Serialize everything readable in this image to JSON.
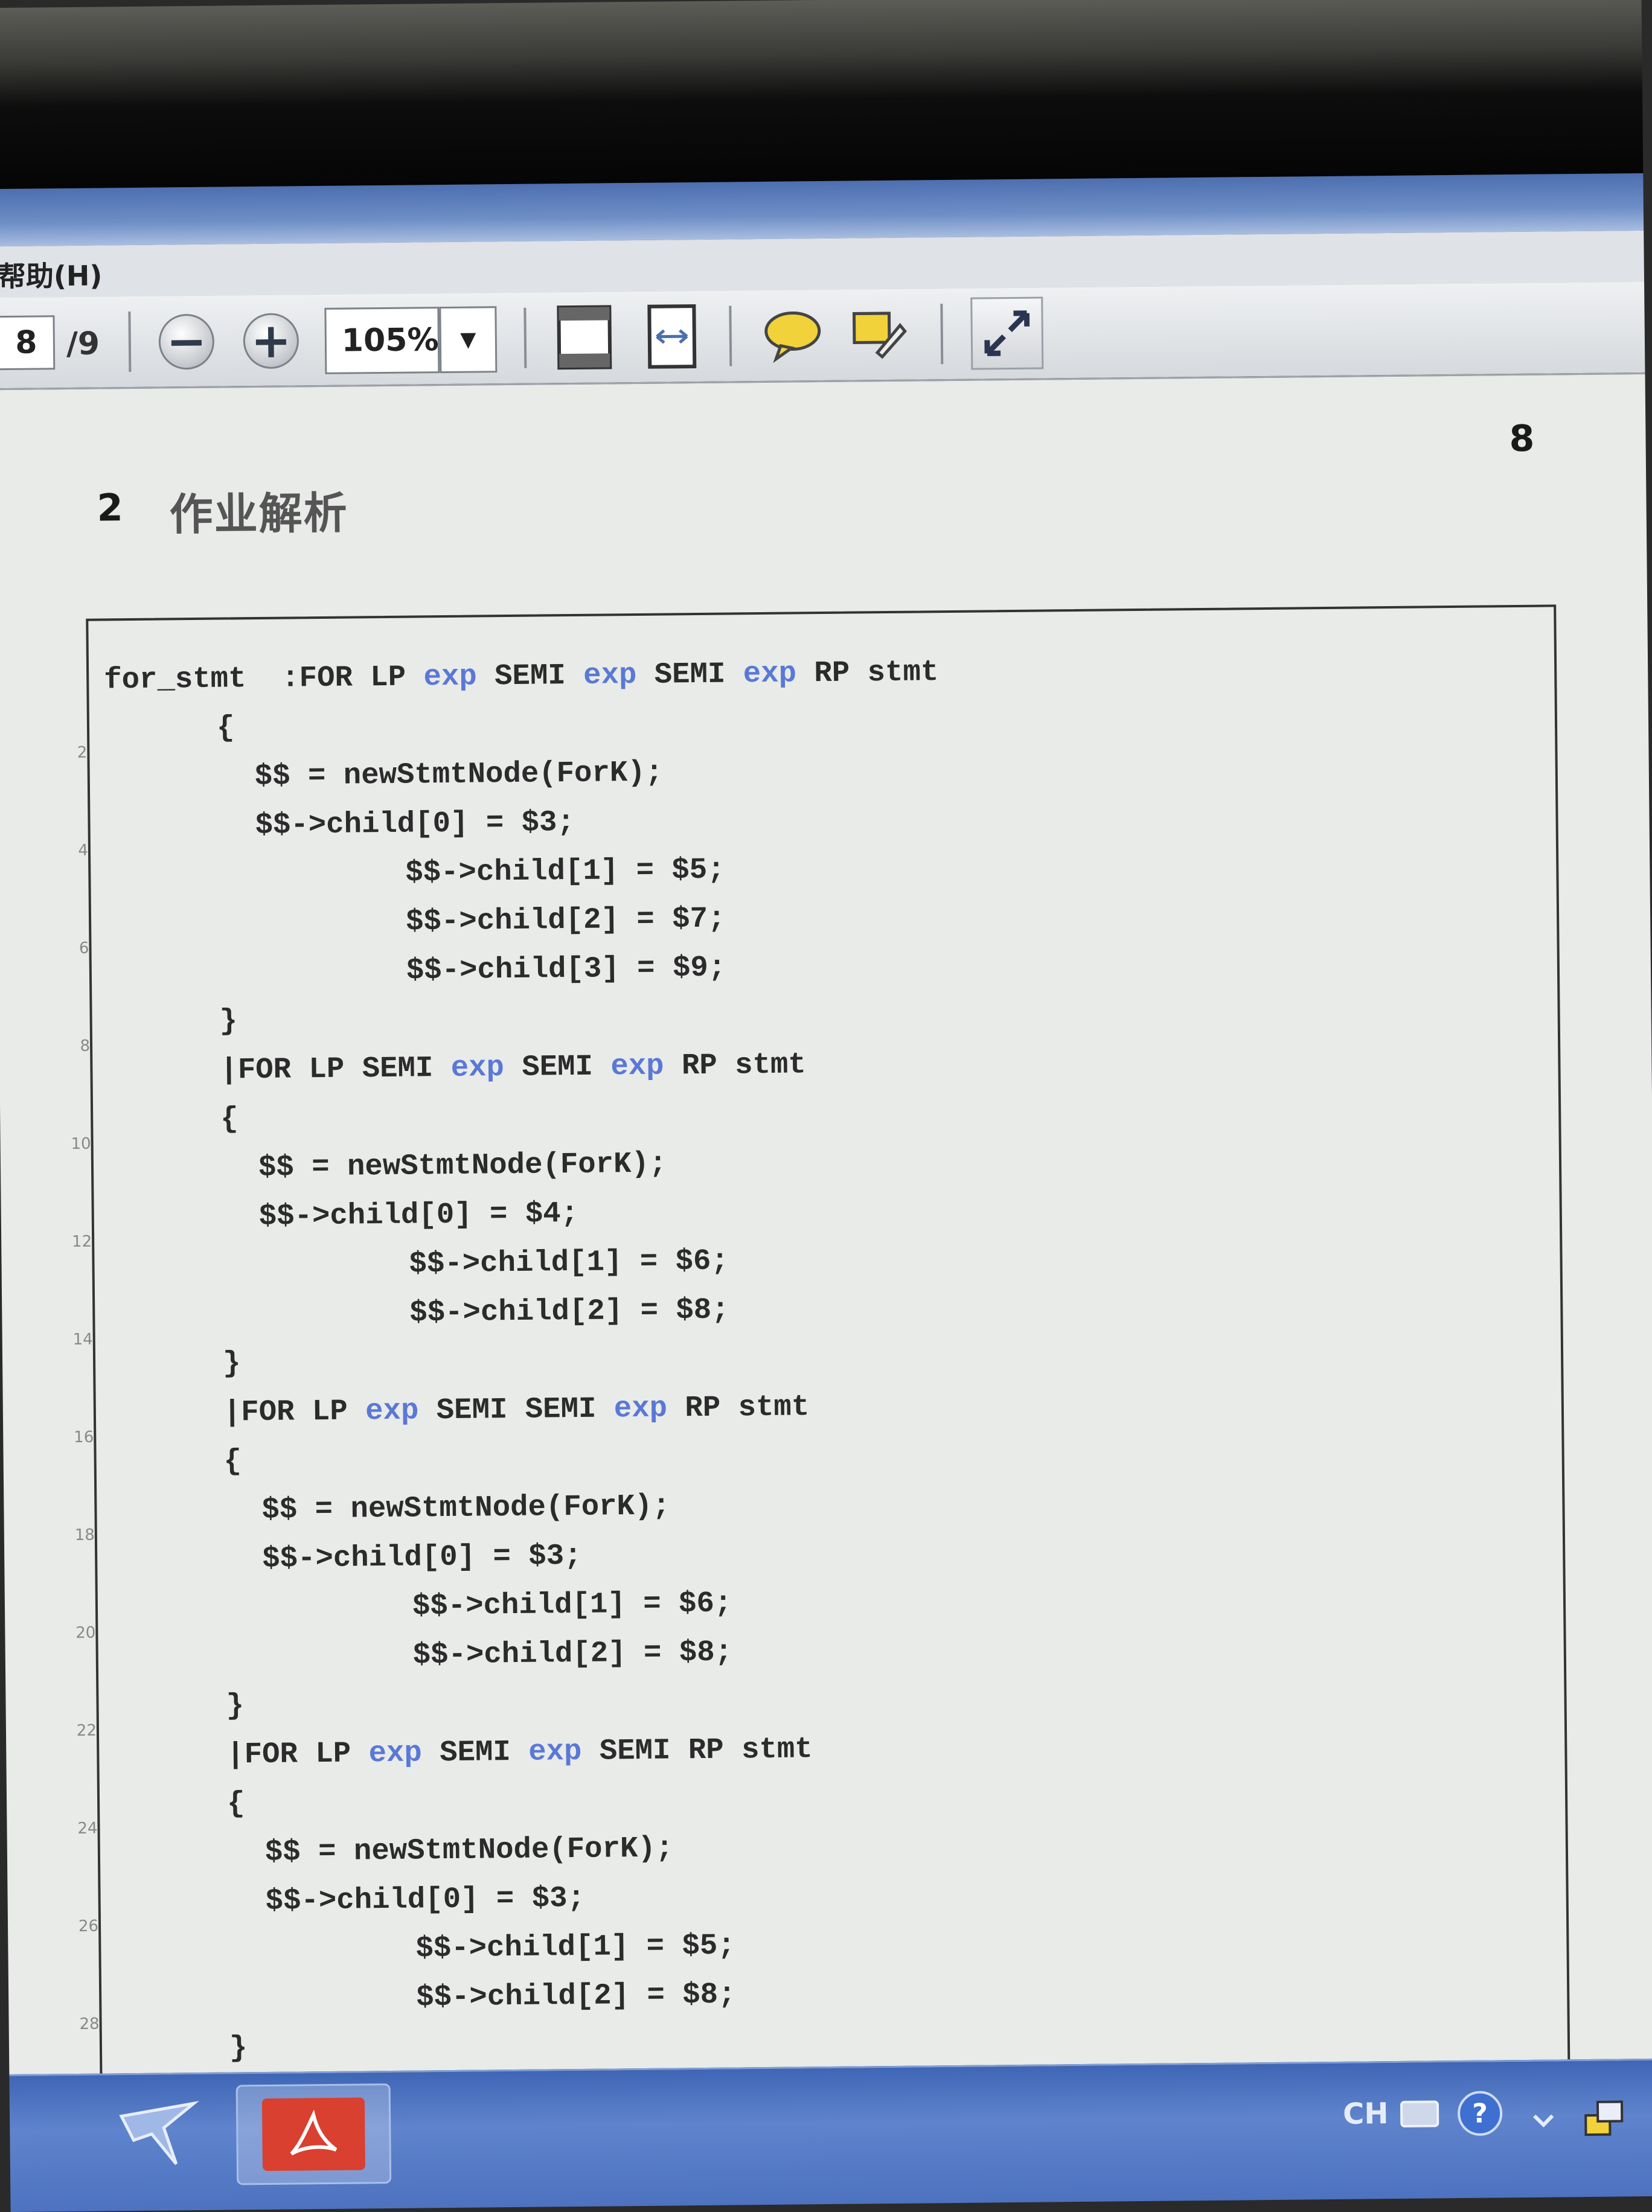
{
  "menu": {
    "help": "帮助(H)"
  },
  "toolbar": {
    "page_current": "8",
    "page_total": "/9",
    "zoom": "105%",
    "icons": [
      "zoom-out-icon",
      "zoom-in-icon",
      "fit-page-icon",
      "fit-width-icon",
      "comment-icon",
      "highlight-icon",
      "fullscreen-icon"
    ]
  },
  "document": {
    "page_number": "8",
    "section_number": "2",
    "section_title": "作业解析",
    "code_lines": [
      {
        "ln": "",
        "indent": 0,
        "parts": [
          [
            "for_stmt  :FOR LP ",
            0
          ],
          [
            "exp",
            1
          ],
          [
            " SEMI ",
            0
          ],
          [
            "exp",
            1
          ],
          [
            " SEMI ",
            0
          ],
          [
            "exp",
            1
          ],
          [
            " RP stmt",
            0
          ]
        ]
      },
      {
        "ln": "2",
        "indent": 3,
        "parts": [
          [
            "{",
            0
          ]
        ]
      },
      {
        "ln": "",
        "indent": 4,
        "parts": [
          [
            "$$ = newStmtNode(ForK);",
            0
          ]
        ]
      },
      {
        "ln": "4",
        "indent": 4,
        "parts": [
          [
            "$$->child[0] = $3;",
            0
          ]
        ]
      },
      {
        "ln": "",
        "indent": 8,
        "parts": [
          [
            "$$->child[1] = $5;",
            0
          ]
        ]
      },
      {
        "ln": "6",
        "indent": 8,
        "parts": [
          [
            "$$->child[2] = $7;",
            0
          ]
        ]
      },
      {
        "ln": "",
        "indent": 8,
        "parts": [
          [
            "$$->child[3] = $9;",
            0
          ]
        ]
      },
      {
        "ln": "8",
        "indent": 3,
        "parts": [
          [
            "}",
            0
          ]
        ]
      },
      {
        "ln": "",
        "indent": 3,
        "parts": [
          [
            "|FOR LP SEMI ",
            0
          ],
          [
            "exp",
            1
          ],
          [
            " SEMI ",
            0
          ],
          [
            "exp",
            1
          ],
          [
            " RP stmt",
            0
          ]
        ]
      },
      {
        "ln": "10",
        "indent": 3,
        "parts": [
          [
            "{",
            0
          ]
        ]
      },
      {
        "ln": "",
        "indent": 4,
        "parts": [
          [
            "$$ = newStmtNode(ForK);",
            0
          ]
        ]
      },
      {
        "ln": "12",
        "indent": 4,
        "parts": [
          [
            "$$->child[0] = $4;",
            0
          ]
        ]
      },
      {
        "ln": "",
        "indent": 8,
        "parts": [
          [
            "$$->child[1] = $6;",
            0
          ]
        ]
      },
      {
        "ln": "14",
        "indent": 8,
        "parts": [
          [
            "$$->child[2] = $8;",
            0
          ]
        ]
      },
      {
        "ln": "",
        "indent": 3,
        "parts": [
          [
            "}",
            0
          ]
        ]
      },
      {
        "ln": "16",
        "indent": 3,
        "parts": [
          [
            "|FOR LP ",
            0
          ],
          [
            "exp",
            1
          ],
          [
            " SEMI SEMI ",
            0
          ],
          [
            "exp",
            1
          ],
          [
            " RP stmt",
            0
          ]
        ]
      },
      {
        "ln": "",
        "indent": 3,
        "parts": [
          [
            "{",
            0
          ]
        ]
      },
      {
        "ln": "18",
        "indent": 4,
        "parts": [
          [
            "$$ = newStmtNode(ForK);",
            0
          ]
        ]
      },
      {
        "ln": "",
        "indent": 4,
        "parts": [
          [
            "$$->child[0] = $3;",
            0
          ]
        ]
      },
      {
        "ln": "20",
        "indent": 8,
        "parts": [
          [
            "$$->child[1] = $6;",
            0
          ]
        ]
      },
      {
        "ln": "",
        "indent": 8,
        "parts": [
          [
            "$$->child[2] = $8;",
            0
          ]
        ]
      },
      {
        "ln": "22",
        "indent": 3,
        "parts": [
          [
            "}",
            0
          ]
        ]
      },
      {
        "ln": "",
        "indent": 3,
        "parts": [
          [
            "|FOR LP ",
            0
          ],
          [
            "exp",
            1
          ],
          [
            " SEMI ",
            0
          ],
          [
            "exp",
            1
          ],
          [
            " SEMI RP stmt",
            0
          ]
        ]
      },
      {
        "ln": "24",
        "indent": 3,
        "parts": [
          [
            "{",
            0
          ]
        ]
      },
      {
        "ln": "",
        "indent": 4,
        "parts": [
          [
            "$$ = newStmtNode(ForK);",
            0
          ]
        ]
      },
      {
        "ln": "26",
        "indent": 4,
        "parts": [
          [
            "$$->child[0] = $3;",
            0
          ]
        ]
      },
      {
        "ln": "",
        "indent": 8,
        "parts": [
          [
            "$$->child[1] = $5;",
            0
          ]
        ]
      },
      {
        "ln": "28",
        "indent": 8,
        "parts": [
          [
            "$$->child[2] = $8;",
            0
          ]
        ]
      },
      {
        "ln": "",
        "indent": 3,
        "parts": [
          [
            "}",
            0
          ]
        ]
      }
    ]
  },
  "taskbar": {
    "tray_language": "CH",
    "apps": [
      "bird-app-icon",
      "pdf-reader-icon"
    ]
  },
  "colors": {
    "keyword": "#5a78d6",
    "taskbar": "#4d72bf",
    "page": "#e9ebe9"
  }
}
